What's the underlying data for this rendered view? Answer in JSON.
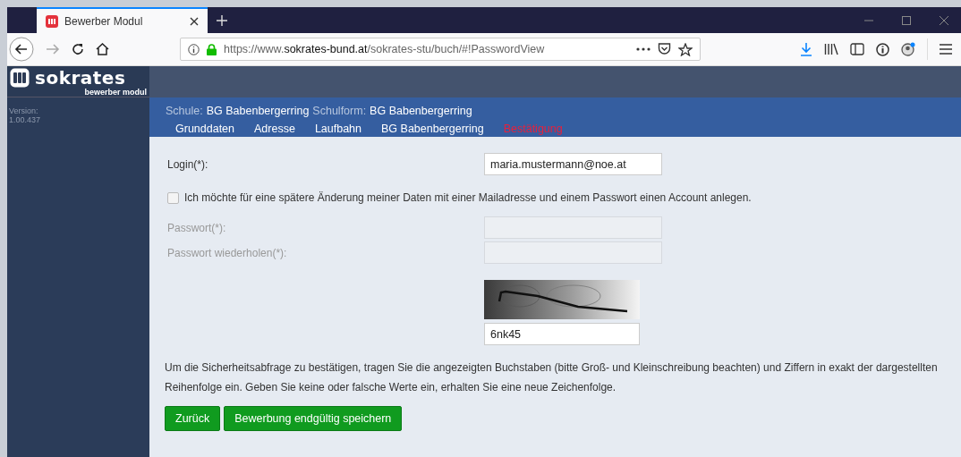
{
  "browser": {
    "tab": {
      "title": "Bewerber Modul",
      "selected": true
    },
    "url": {
      "scheme": "https://www.",
      "host": "sokrates-bund.at",
      "path": "/sokrates-stu/buch/#!PasswordView"
    }
  },
  "sidebar": {
    "logo": "sokrates",
    "subtitle": "bewerber modul",
    "version_label": "Version:",
    "version": "1.00.437"
  },
  "header": {
    "school_label": "Schule:",
    "school": "BG Babenbergerring",
    "form_label": "Schulform:",
    "form": "BG Babenbergerring"
  },
  "nav": [
    {
      "label": "Grunddaten",
      "selected": false
    },
    {
      "label": "Adresse",
      "selected": false
    },
    {
      "label": "Laufbahn",
      "selected": false
    },
    {
      "label": "BG Babenbergerring",
      "selected": false
    },
    {
      "label": "Bestätigung",
      "selected": true
    }
  ],
  "login": {
    "label": "Login(*):",
    "value": "maria.mustermann@noe.at"
  },
  "account_checkbox": {
    "label": "Ich möchte für eine spätere Änderung meiner Daten mit einer Mailadresse und einem Passwort einen Account anlegen.",
    "checked": false
  },
  "password_fields": [
    {
      "label": "Passwort(*):",
      "disabled": true
    },
    {
      "label": "Passwort wiederholen(*):",
      "disabled": true
    }
  ],
  "captcha": {
    "kind": "picture",
    "value": "6nk45"
  },
  "hint": "Um die Sicherheitsabfrage zu bestätigen, tragen Sie die angezeigten Buchstaben (bitte Groß- und Kleinschreibung beachten) und Ziffern in exakt der dargestellten Reihenfolge ein. Geben Sie keine oder falsche Werte ein, erhalten Sie eine neue Zeichenfolge.",
  "buttons": [
    "Zurück",
    "Bewerbung endgültig speichern"
  ]
}
